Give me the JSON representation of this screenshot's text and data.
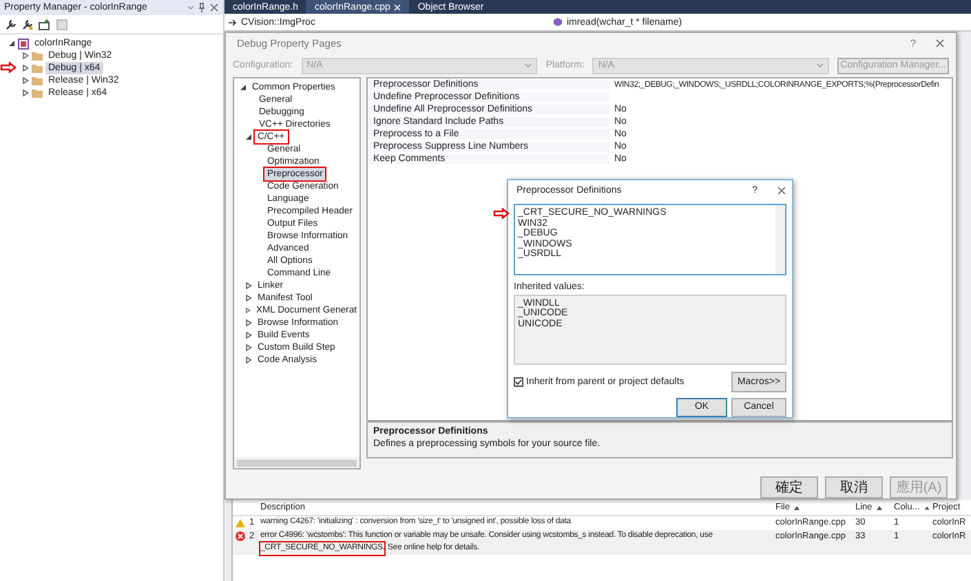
{
  "property_manager": {
    "title": "Property Manager - colorInRange",
    "tree": [
      {
        "label": "colorInRange",
        "kind": "project",
        "expanded": true,
        "selected": false,
        "arrow": false,
        "children": [
          {
            "label": "Debug | Win32",
            "kind": "folder",
            "expanded": false,
            "selected": false,
            "arrow": false
          },
          {
            "label": "Debug | x64",
            "kind": "folder",
            "expanded": false,
            "selected": true,
            "arrow": true
          },
          {
            "label": "Release | Win32",
            "kind": "folder",
            "expanded": false,
            "selected": false,
            "arrow": false
          },
          {
            "label": "Release | x64",
            "kind": "folder",
            "expanded": false,
            "selected": false,
            "arrow": false
          }
        ]
      }
    ]
  },
  "editor": {
    "tabs": [
      {
        "label": "colorInRange.h",
        "selected": false
      },
      {
        "label": "colorInRange.cpp",
        "selected": true
      },
      {
        "label": "Object Browser",
        "selected": false
      }
    ],
    "scope": "CVision::ImgProc",
    "member": "imread(wchar_t * filename)"
  },
  "property_pages": {
    "title": "Debug Property Pages",
    "help_button": "?",
    "configuration_label": "Configuration:",
    "configuration": "N/A",
    "platform_label": "Platform:",
    "platform": "N/A",
    "configuration_manager": "Configuration Manager...",
    "tree": [
      {
        "label": "Common Properties",
        "expanded": true,
        "selected": false,
        "boxed": false,
        "children": [
          {
            "label": "General",
            "selected": false,
            "boxed": false
          },
          {
            "label": "Debugging",
            "selected": false,
            "boxed": false
          },
          {
            "label": "VC++ Directories",
            "selected": false,
            "boxed": false
          },
          {
            "label": "C/C++",
            "expanded": true,
            "selected": false,
            "boxed": true,
            "children": [
              {
                "label": "General",
                "selected": false,
                "boxed": false
              },
              {
                "label": "Optimization",
                "selected": false,
                "boxed": false
              },
              {
                "label": "Preprocessor",
                "selected": true,
                "boxed": true
              },
              {
                "label": "Code Generation",
                "selected": false,
                "boxed": false
              },
              {
                "label": "Language",
                "selected": false,
                "boxed": false
              },
              {
                "label": "Precompiled Header",
                "selected": false,
                "boxed": false
              },
              {
                "label": "Output Files",
                "selected": false,
                "boxed": false
              },
              {
                "label": "Browse Information",
                "selected": false,
                "boxed": false
              },
              {
                "label": "Advanced",
                "selected": false,
                "boxed": false
              },
              {
                "label": "All Options",
                "selected": false,
                "boxed": false
              },
              {
                "label": "Command Line",
                "selected": false,
                "boxed": false
              }
            ]
          },
          {
            "label": "Linker",
            "expanded": false,
            "selected": false,
            "boxed": false
          },
          {
            "label": "Manifest Tool",
            "expanded": false,
            "selected": false,
            "boxed": false
          },
          {
            "label": "XML Document Generat",
            "expanded": false,
            "selected": false,
            "boxed": false
          },
          {
            "label": "Browse Information",
            "expanded": false,
            "selected": false,
            "boxed": false
          },
          {
            "label": "Build Events",
            "expanded": false,
            "selected": false,
            "boxed": false
          },
          {
            "label": "Custom Build Step",
            "expanded": false,
            "selected": false,
            "boxed": false
          },
          {
            "label": "Code Analysis",
            "expanded": false,
            "selected": false,
            "boxed": false
          }
        ]
      }
    ],
    "properties": [
      {
        "name": "Preprocessor Definitions",
        "value": "WIN32;_DEBUG;_WINDOWS;_USRDLL;COLORINRANGE_EXPORTS;%(PreprocessorDefin"
      },
      {
        "name": "Undefine Preprocessor Definitions"
      },
      {
        "name": "Undefine All Preprocessor Definitions",
        "value": "No"
      },
      {
        "name": "Ignore Standard Include Paths",
        "value": "No"
      },
      {
        "name": "Preprocess to a File",
        "value": "No"
      },
      {
        "name": "Preprocess Suppress Line Numbers",
        "value": "No"
      },
      {
        "name": "Keep Comments",
        "value": "No"
      }
    ],
    "description": {
      "title": "Preprocessor Definitions",
      "text": "Defines a preprocessing symbols for your source file."
    },
    "buttons": [
      {
        "label": "確定",
        "disabled": false
      },
      {
        "label": "取消",
        "disabled": false
      },
      {
        "label": "應用(A)",
        "disabled": true
      }
    ]
  },
  "preprocessor_dialog": {
    "title": "Preprocessor Definitions",
    "help_button": "?",
    "definitions": [
      {
        "text": "_CRT_SECURE_NO_WARNINGS",
        "arrow": true
      },
      {
        "text": "WIN32",
        "arrow": false
      },
      {
        "text": "_DEBUG",
        "arrow": false
      },
      {
        "text": "_WINDOWS",
        "arrow": false
      },
      {
        "text": "_USRDLL",
        "arrow": false
      }
    ],
    "inherited_label": "Inherited values:",
    "inherited": [
      "_WINDLL",
      "_UNICODE",
      "UNICODE"
    ],
    "inherit_checkbox": {
      "label": "Inherit from parent or project defaults",
      "checked": true
    },
    "macros_button": "Macros>>",
    "ok_button": "OK",
    "cancel_button": "Cancel"
  },
  "error_list": {
    "columns": [
      {
        "label": "Description",
        "sorted": false
      },
      {
        "label": "File",
        "sorted": true
      },
      {
        "label": "Line",
        "sorted": true
      },
      {
        "label": "Colu...",
        "sorted": true
      },
      {
        "label": "Project",
        "sorted": false
      }
    ],
    "rows": [
      {
        "kind": "warning",
        "number": "1",
        "lines": [
          [
            {
              "text": "warning C4267: 'initializing' : conversion from 'size_t' to 'unsigned int', possible loss of data",
              "boxed": false
            }
          ]
        ],
        "file": "colorInRange.cpp",
        "line": "30",
        "column": "1",
        "project": "colorInR"
      },
      {
        "kind": "error",
        "number": "2",
        "lines": [
          [
            {
              "text": "error C4996: 'wcstombs': This function or variable may be unsafe. Consider using wcstombs_s instead. To disable deprecation, use",
              "boxed": false
            }
          ],
          [
            {
              "text": "_CRT_SECURE_NO_WARNINGS.",
              "boxed": true
            },
            {
              "text": "See online help for details.",
              "boxed": false
            }
          ]
        ],
        "file": "colorInRange.cpp",
        "line": "33",
        "column": "1",
        "project": "colorInR"
      }
    ]
  }
}
